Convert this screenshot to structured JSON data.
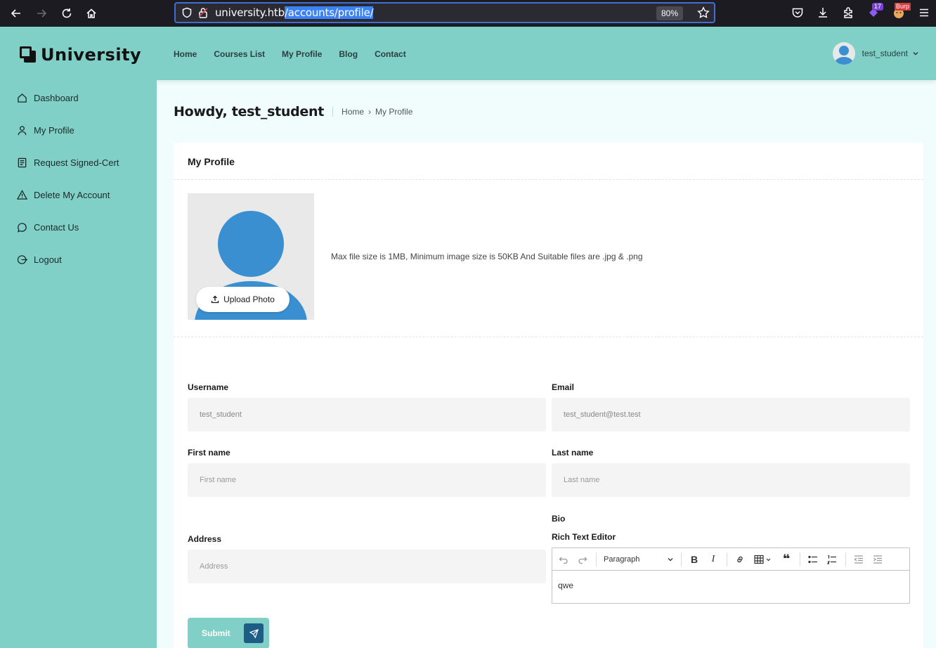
{
  "browser": {
    "url_host": "university.htb",
    "url_path": "/accounts/profile/",
    "zoom": "80%",
    "ext_badge": "17",
    "burp_badge": "Burp"
  },
  "header": {
    "logo_text": "University",
    "nav": [
      "Home",
      "Courses List",
      "My Profile",
      "Blog",
      "Contact"
    ],
    "user_name": "test_student"
  },
  "sidebar": {
    "items": [
      {
        "label": "Dashboard",
        "icon": "home-icon"
      },
      {
        "label": "My Profile",
        "icon": "user-icon"
      },
      {
        "label": "Request Signed-Cert",
        "icon": "document-icon"
      },
      {
        "label": "Delete My Account",
        "icon": "warning-icon"
      },
      {
        "label": "Contact Us",
        "icon": "chat-icon"
      },
      {
        "label": "Logout",
        "icon": "logout-icon"
      }
    ]
  },
  "page": {
    "title": "Howdy, test_student",
    "breadcrumb_home": "Home",
    "breadcrumb_current": "My Profile"
  },
  "card": {
    "title": "My Profile",
    "upload_label": "Upload Photo",
    "photo_hint": "Max file size is 1MB, Minimum image size is 50KB And Suitable files are .jpg & .png"
  },
  "form": {
    "username_label": "Username",
    "username_value": "test_student",
    "email_label": "Email",
    "email_value": "test_student@test.test",
    "firstname_label": "First name",
    "firstname_placeholder": "First name",
    "lastname_label": "Last name",
    "lastname_placeholder": "Last name",
    "bio_label": "Bio",
    "rte_label": "Rich Text Editor",
    "rte_format": "Paragraph",
    "rte_content": "qwe",
    "address_label": "Address",
    "address_placeholder": "Address",
    "submit_label": "Submit"
  },
  "colors": {
    "accent": "#81d0c7",
    "submit_icon_bg": "#1e5e86",
    "avatar_blue": "#3a8fd0"
  }
}
